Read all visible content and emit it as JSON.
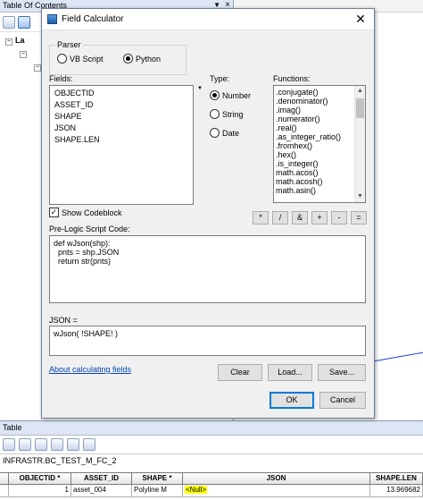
{
  "toc": {
    "title": "Table Of Contents",
    "layers_label": "La",
    "pin_icon": "pin-icon",
    "close_icon": "close-icon"
  },
  "table": {
    "title": "Table",
    "tab_name": "INFRASTR.BC_TEST_M_FC_2",
    "columns": [
      "OBJECTID *",
      "ASSET_ID",
      "SHAPE *",
      "JSON",
      "SHAPE.LEN"
    ],
    "rows": [
      {
        "marker": "",
        "objectid": "1",
        "asset_id": "asset_004",
        "shape": "Polyline M",
        "json": "<Null>",
        "shape_len": "13.969682"
      }
    ]
  },
  "dialog": {
    "title": "Field Calculator",
    "parser_label": "Parser",
    "parser_options": [
      "VB Script",
      "Python"
    ],
    "parser_selected": "Python",
    "fields_label": "Fields:",
    "fields": [
      "OBJECTID",
      "ASSET_ID",
      "SHAPE",
      "JSON",
      "SHAPE.LEN"
    ],
    "type_label": "Type:",
    "type_options": [
      "Number",
      "String",
      "Date"
    ],
    "type_selected": "Number",
    "functions_label": "Functions:",
    "functions": [
      ".conjugate()",
      ".denominator()",
      ".imag()",
      ".numerator()",
      ".real()",
      ".as_integer_ratio()",
      ".fromhex()",
      ".hex()",
      ".is_integer()",
      "math.acos()",
      "math.acosh()",
      "math.asin()"
    ],
    "show_codeblock_label": "Show Codeblock",
    "show_codeblock_checked": true,
    "operators": [
      "*",
      "/",
      "&",
      "+",
      "-",
      "="
    ],
    "prelogic_label": "Pre-Logic Script Code:",
    "prelogic_code": "def wJson(shp):\n  pnts = shp.JSON\n  return str(pnts)",
    "expression_label": "JSON =",
    "expression": "wJson( !SHAPE! )",
    "help_link": "About calculating fields",
    "clear_button": "Clear",
    "load_button": "Load...",
    "save_button": "Save...",
    "ok_button": "OK",
    "cancel_button": "Cancel"
  }
}
